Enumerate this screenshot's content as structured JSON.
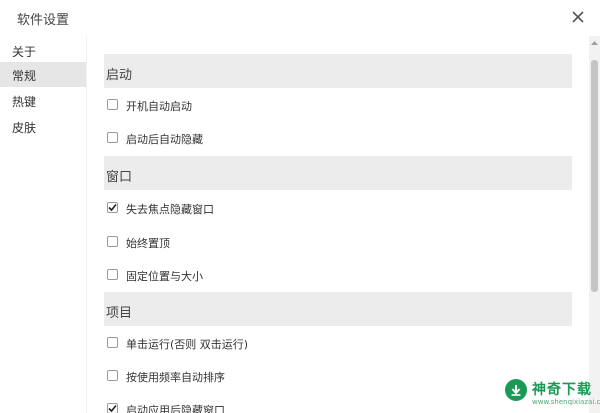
{
  "window": {
    "title": "软件设置"
  },
  "sidebar": {
    "items": [
      {
        "label": "关于",
        "active": false
      },
      {
        "label": "常规",
        "active": true
      },
      {
        "label": "热键",
        "active": false
      },
      {
        "label": "皮肤",
        "active": false
      }
    ]
  },
  "sections": [
    {
      "title": "启动",
      "options": [
        {
          "label": "开机自动启动",
          "checked": false
        },
        {
          "label": "启动后自动隐藏",
          "checked": false
        }
      ]
    },
    {
      "title": "窗口",
      "options": [
        {
          "label": "失去焦点隐藏窗口",
          "checked": true
        },
        {
          "label": "始终置顶",
          "checked": false
        },
        {
          "label": "固定位置与大小",
          "checked": false
        }
      ]
    },
    {
      "title": "项目",
      "options": [
        {
          "label": "单击运行(否则 双击运行)",
          "checked": false
        },
        {
          "label": "按使用频率自动排序",
          "checked": false
        },
        {
          "label": "启动应用后隐藏窗口",
          "checked": true
        }
      ]
    }
  ],
  "watermark": {
    "name": "神奇下载",
    "url": "www.shenqixiazai.com"
  },
  "colors": {
    "accent": "#1a9a55",
    "section_bg": "#ececec",
    "active_nav_bg": "#e6e6e6"
  },
  "icons": {
    "close": "close-icon",
    "check": "checkmark-icon"
  }
}
